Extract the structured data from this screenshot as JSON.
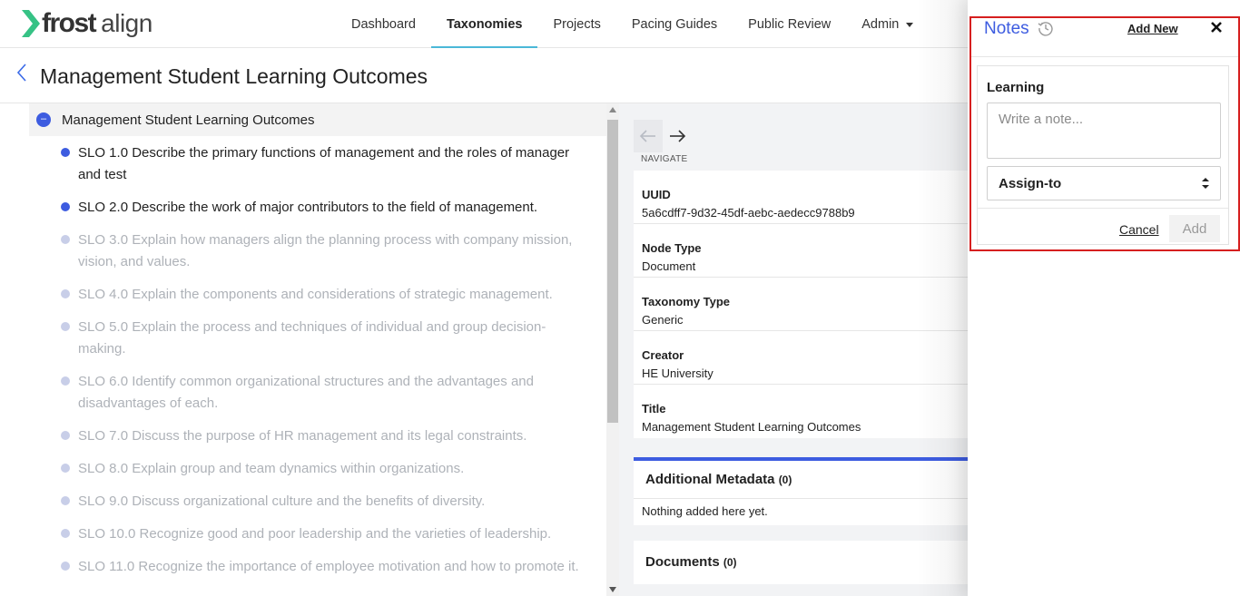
{
  "brand": {
    "name_bold": "frost",
    "name_light": "align",
    "accent": "#3d5ce0"
  },
  "nav": [
    {
      "label": "Dashboard"
    },
    {
      "label": "Taxonomies",
      "active": true
    },
    {
      "label": "Projects"
    },
    {
      "label": "Pacing Guides"
    },
    {
      "label": "Public Review"
    },
    {
      "label": "Admin",
      "dropdown": true
    }
  ],
  "page": {
    "title": "Management Student Learning Outcomes"
  },
  "tree": {
    "root": {
      "label": "Management Student Learning Outcomes",
      "toggle": "–"
    },
    "items": [
      {
        "label": "SLO 1.0 Describe the primary functions of management and the roles of manager and test",
        "active": true
      },
      {
        "label": "SLO 2.0 Describe the work of major contributors to the field of management.",
        "active": true
      },
      {
        "label": "SLO 3.0 Explain how managers align the planning process with company mission, vision, and values.",
        "active": false
      },
      {
        "label": "SLO 4.0 Explain the components and considerations of strategic management.",
        "active": false
      },
      {
        "label": "SLO 5.0 Explain the process and techniques of individual and group decision-making.",
        "active": false
      },
      {
        "label": "SLO 6.0 Identify common organizational structures and the advantages and disadvantages of each.",
        "active": false
      },
      {
        "label": "SLO 7.0 Discuss the purpose of HR management and its legal constraints.",
        "active": false
      },
      {
        "label": "SLO 8.0 Explain group and team dynamics within organizations.",
        "active": false
      },
      {
        "label": "SLO 9.0 Discuss organizational culture and the benefits of diversity.",
        "active": false
      },
      {
        "label": "SLO 10.0 Recognize good and poor leadership and the varieties of leadership.",
        "active": false
      },
      {
        "label": "SLO 11.0 Recognize the importance of employee motivation and how to promote it.",
        "active": false
      }
    ]
  },
  "details": {
    "navigate_label": "NAVIGATE",
    "fields": [
      {
        "label": "UUID",
        "value": "5a6cdff7-9d32-45df-aebc-aedecc9788b9"
      },
      {
        "label": "Node Type",
        "value": "Document"
      },
      {
        "label": "Taxonomy Type",
        "value": "Generic"
      },
      {
        "label": "Creator",
        "value": "HE University"
      },
      {
        "label": "Title",
        "value": "Management Student Learning Outcomes"
      }
    ],
    "additional_metadata": {
      "title": "Additional Metadata",
      "count": "(0)",
      "empty_text": "Nothing added here yet."
    },
    "documents": {
      "title": "Documents",
      "count": "(0)"
    }
  },
  "notes": {
    "title": "Notes",
    "add_new": "Add New",
    "card": {
      "heading": "Learning",
      "placeholder": "Write a note...",
      "assign_label": "Assign-to",
      "cancel": "Cancel",
      "add": "Add"
    },
    "highlight_color": "#d61f1f"
  }
}
